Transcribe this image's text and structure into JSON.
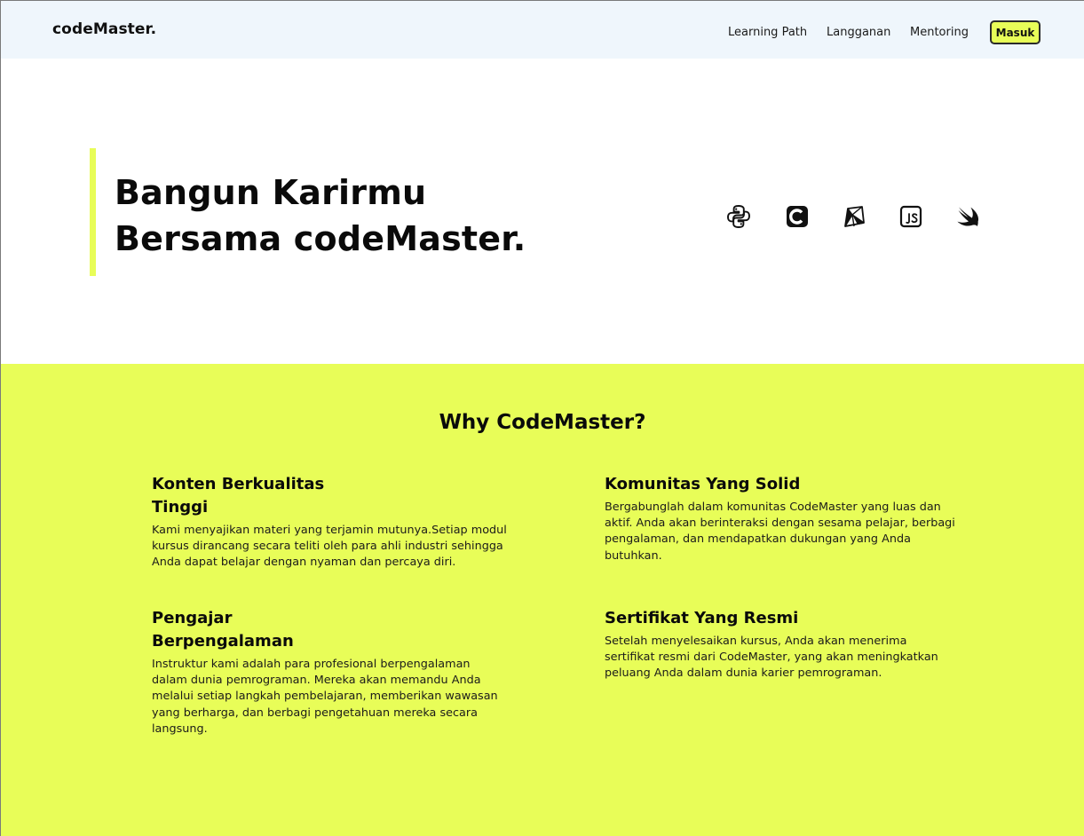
{
  "navbar": {
    "brand": "codeMaster.",
    "links": [
      "Learning Path",
      "Langganan",
      "Mentoring"
    ],
    "login_label": "Masuk",
    "background_color": "#eff6fc"
  },
  "hero": {
    "title_line1": "Bangun Karirmu",
    "title_line2": "Bersama codeMaster.",
    "accent_color": "#e8fd58",
    "language_icons": [
      "python-icon",
      "c-icon",
      "ruby-icon",
      "javascript-icon",
      "swift-icon"
    ]
  },
  "why": {
    "title": "Why CodeMaster?",
    "background_color": "#e8fd58",
    "features": [
      {
        "title": "Konten Berkualitas Tinggi",
        "description": "Kami menyajikan materi yang terjamin mutunya.Setiap modul kursus dirancang secara teliti oleh para ahli industri sehingga Anda dapat belajar dengan nyaman dan percaya diri."
      },
      {
        "title": "Komunitas Yang Solid",
        "description": "Bergabunglah dalam komunitas CodeMaster yang luas dan aktif. Anda akan berinteraksi dengan sesama pelajar, berbagi pengalaman, dan mendapatkan dukungan yang Anda butuhkan."
      },
      {
        "title": "Pengajar Berpengalaman",
        "description": "Instruktur kami adalah para profesional berpengalaman dalam dunia pemrograman. Mereka akan memandu Anda melalui setiap langkah pembelajaran, memberikan wawasan yang berharga, dan berbagi pengetahuan mereka secara langsung."
      },
      {
        "title": "Sertifikat Yang Resmi",
        "description": "Setelah menyelesaikan kursus, Anda akan menerima sertifikat resmi dari CodeMaster, yang akan meningkatkan peluang Anda dalam dunia karier pemrograman."
      }
    ]
  }
}
